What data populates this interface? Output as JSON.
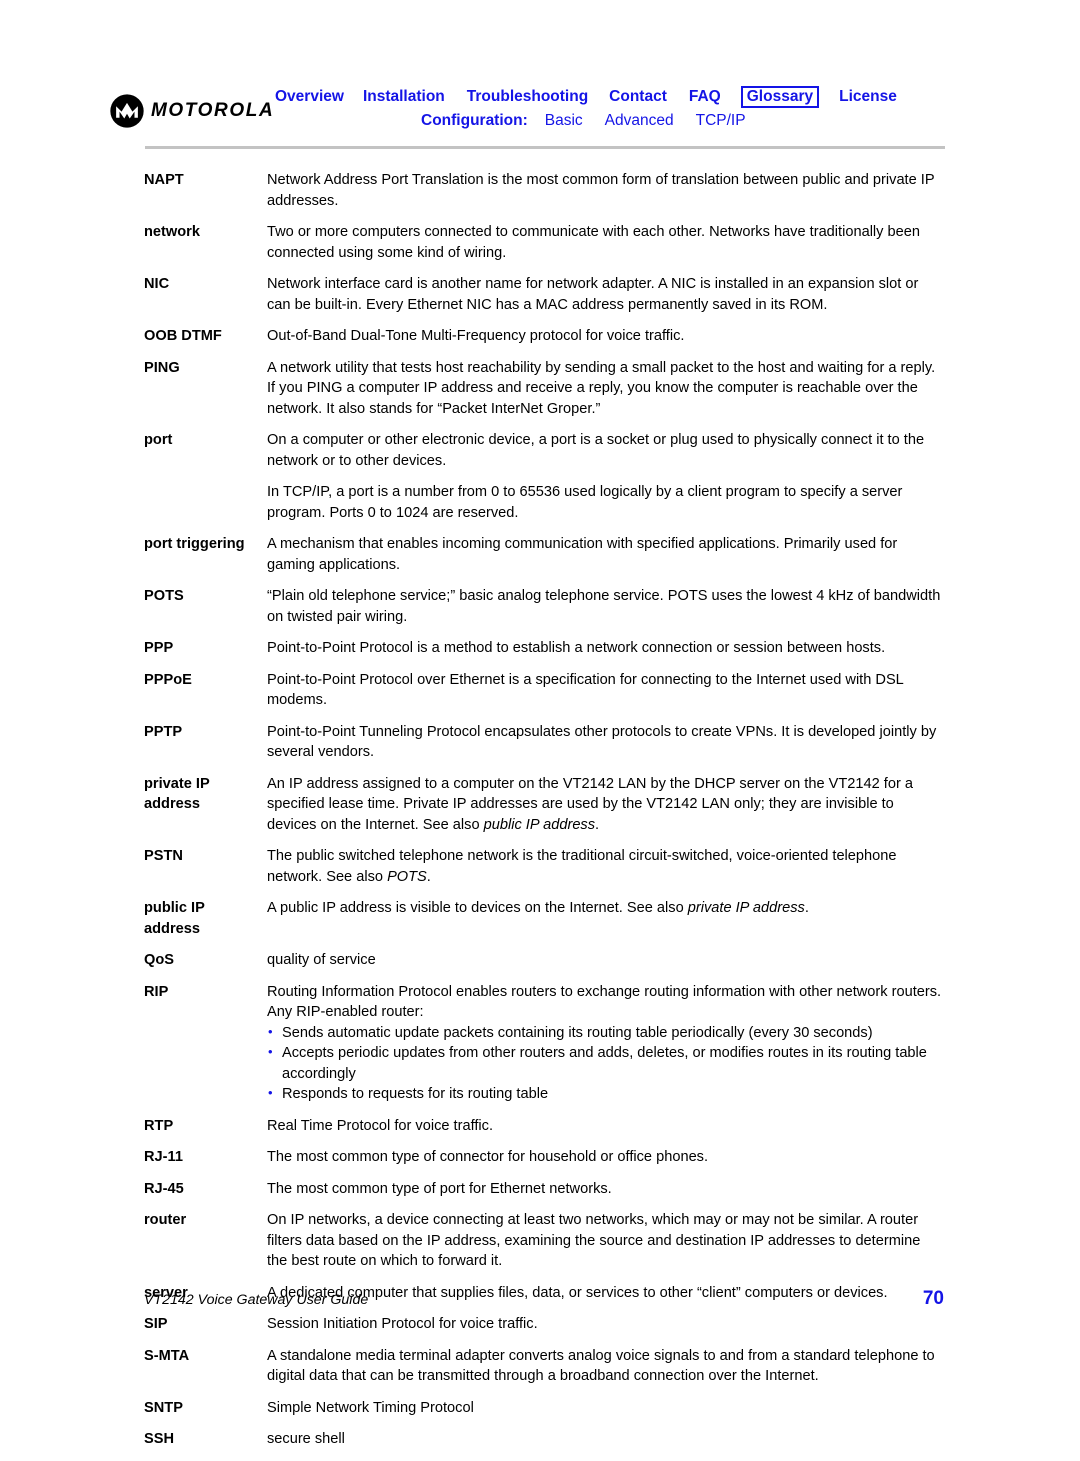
{
  "header": {
    "logo_word": "MOTOROLA",
    "logo_icon": "motorola-batwing-logo",
    "nav_primary": [
      {
        "label": "Overview",
        "current": false
      },
      {
        "label": "Installation",
        "current": false
      },
      {
        "label": "Troubleshooting",
        "current": false
      },
      {
        "label": "Contact",
        "current": false
      },
      {
        "label": "FAQ",
        "current": false
      },
      {
        "label": "Glossary",
        "current": true
      },
      {
        "label": "License",
        "current": false
      }
    ],
    "config_label": "Configuration:",
    "nav_config": [
      {
        "label": "Basic"
      },
      {
        "label": "Advanced"
      },
      {
        "label": "TCP/IP"
      }
    ],
    "link_color": "#1414e6",
    "rule_color": "#c3c3c3"
  },
  "glossary": {
    "entries": [
      {
        "term": "NAPT",
        "paragraphs": [
          "Network Address Port Translation is the most common form of translation between public and private IP addresses."
        ]
      },
      {
        "term": "network",
        "paragraphs": [
          "Two or more computers connected to communicate with each other. Networks have traditionally been connected using some kind of wiring."
        ]
      },
      {
        "term": "NIC",
        "paragraphs": [
          "Network interface card is another name for network adapter. A NIC is installed in an expansion slot or can be built-in. Every Ethernet NIC has a MAC address permanently saved in its ROM."
        ]
      },
      {
        "term": "OOB DTMF",
        "paragraphs": [
          "Out-of-Band Dual-Tone Multi-Frequency protocol for voice traffic."
        ]
      },
      {
        "term": "PING",
        "paragraphs": [
          "A network utility that tests host reachability by sending a small packet to the host and waiting for a reply. If you PING a computer IP address and receive a reply, you know the computer is reachable over the network. It also stands for “Packet InterNet Groper.”"
        ]
      },
      {
        "term": "port",
        "paragraphs": [
          "On a computer or other electronic device, a port is a socket or plug used to physically connect it to the network or to other devices.",
          "In TCP/IP, a port is a number from 0 to 65536 used logically by a client program to specify a server program. Ports 0 to 1024 are reserved."
        ]
      },
      {
        "term": "port triggering",
        "paragraphs": [
          "A mechanism that enables incoming communication with specified applications. Primarily used for gaming applications."
        ]
      },
      {
        "term": "POTS",
        "paragraphs": [
          "“Plain old telephone service;” basic analog telephone service. POTS uses the lowest 4 kHz of bandwidth on twisted pair wiring."
        ]
      },
      {
        "term": "PPP",
        "paragraphs": [
          "Point-to-Point Protocol is a method to establish a network connection or session between hosts."
        ]
      },
      {
        "term": "PPPoE",
        "paragraphs": [
          "Point-to-Point Protocol over Ethernet is a specification for connecting to the Internet used with DSL modems."
        ]
      },
      {
        "term": "PPTP",
        "paragraphs": [
          "Point-to-Point Tunneling Protocol encapsulates other protocols to create VPNs. It is developed jointly by several vendors."
        ]
      },
      {
        "term": "private IP address",
        "paragraphs_html": [
          "An IP address assigned to a computer on the VT2142 LAN by the DHCP server on the VT2142 for a specified lease time. Private IP addresses are used by the VT2142 LAN only; they are invisible to devices on the Internet. See also <i>public IP address</i>."
        ]
      },
      {
        "term": "PSTN",
        "paragraphs_html": [
          "The public switched telephone network is the traditional circuit-switched, voice-oriented telephone network. See also <i>POTS</i>."
        ]
      },
      {
        "term": "public IP address",
        "paragraphs_html": [
          "A public IP address is visible to devices on the Internet. See also <i>private IP address</i>."
        ]
      },
      {
        "term": "QoS",
        "paragraphs": [
          "quality of service"
        ]
      },
      {
        "term": "RIP",
        "paragraphs": [
          "Routing Information Protocol enables routers to exchange routing information with other network routers. Any RIP-enabled router:"
        ],
        "bullets": [
          "Sends automatic update packets containing its routing table periodically (every 30 seconds)",
          "Accepts periodic updates from other routers and adds, deletes, or modifies routes in its routing table accordingly",
          "Responds to requests for its routing table"
        ]
      },
      {
        "term": "RTP",
        "paragraphs": [
          "Real Time Protocol for voice traffic."
        ]
      },
      {
        "term": "RJ-11",
        "paragraphs": [
          "The most common type of connector for household or office phones."
        ]
      },
      {
        "term": "RJ-45",
        "paragraphs": [
          "The most common type of port for Ethernet networks."
        ]
      },
      {
        "term": "router",
        "paragraphs": [
          "On IP networks, a device connecting at least two networks, which may or may not be similar. A router filters data based on the IP address, examining the source and destination IP addresses to determine the best route on which to forward it."
        ]
      },
      {
        "term": "server",
        "paragraphs": [
          "A dedicated computer that supplies files, data, or services to other “client” computers or devices."
        ]
      },
      {
        "term": "SIP",
        "paragraphs": [
          "Session Initiation Protocol for voice traffic."
        ]
      },
      {
        "term": "S-MTA",
        "paragraphs": [
          "A standalone media terminal adapter converts analog voice signals to and from a standard telephone to digital data that can be transmitted through a broadband connection over the Internet."
        ]
      },
      {
        "term": "SNTP",
        "paragraphs": [
          "Simple Network Timing Protocol"
        ]
      },
      {
        "term": "SSH",
        "paragraphs": [
          "secure shell"
        ]
      }
    ]
  },
  "footer": {
    "title": "VT2142 Voice Gateway User Guide",
    "page_number": "70",
    "page_number_color": "#1414e6"
  }
}
